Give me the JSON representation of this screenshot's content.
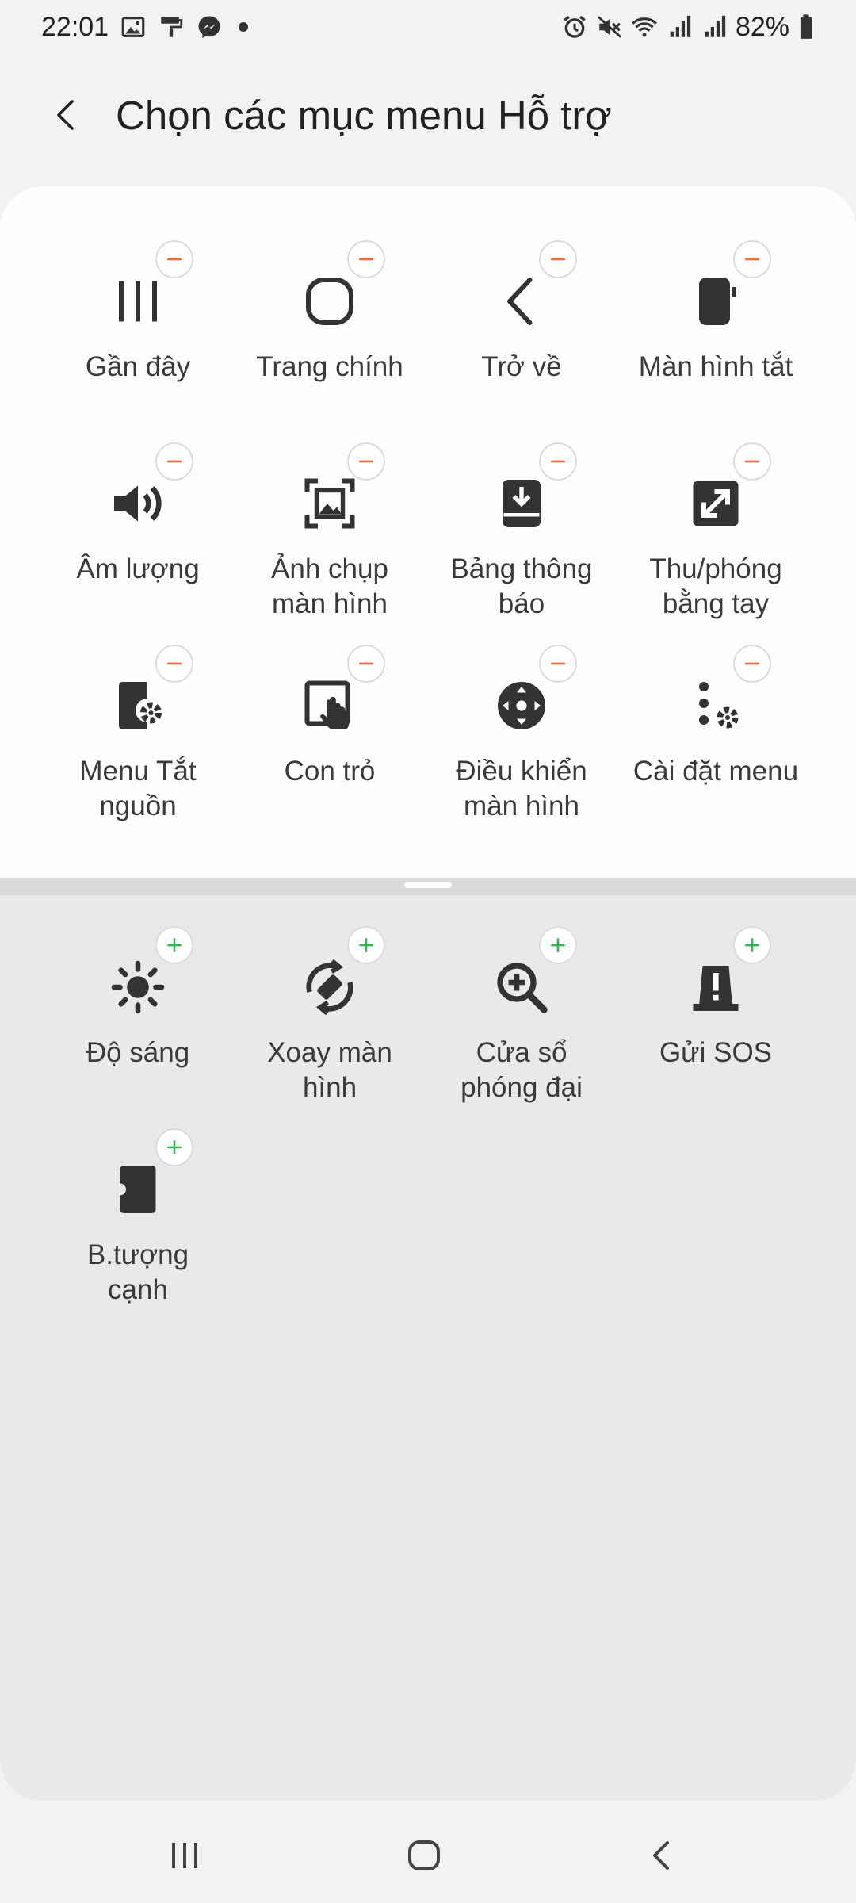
{
  "status_bar": {
    "time": "22:01",
    "battery": "82%",
    "left_icons": [
      "gallery-icon",
      "paint-roller-icon",
      "messenger-icon"
    ],
    "right_icons": [
      "alarm-icon",
      "mute-icon",
      "wifi-icon",
      "signal-icon",
      "signal-icon",
      "battery-icon"
    ]
  },
  "header": {
    "title": "Chọn các mục menu Hỗ trợ"
  },
  "colors": {
    "remove_badge": "#f06a3a",
    "add_badge": "#2fb34d",
    "icon": "#333333",
    "active_bg": "#fdfdfd",
    "available_bg": "#e9e9e9"
  },
  "active_items": [
    {
      "label": "Gần đây",
      "icon": "recents-icon"
    },
    {
      "label": "Trang chính",
      "icon": "home-icon"
    },
    {
      "label": "Trở về",
      "icon": "back-icon"
    },
    {
      "label": "Màn hình tắt",
      "icon": "screen-off-icon"
    },
    {
      "label": "Âm lượng",
      "icon": "volume-icon"
    },
    {
      "label": "Ảnh chụp\nmàn hình",
      "icon": "screenshot-icon"
    },
    {
      "label": "Bảng thông\nbáo",
      "icon": "notification-panel-icon"
    },
    {
      "label": "Thu/phóng\nbằng tay",
      "icon": "pinch-zoom-icon"
    },
    {
      "label": "Menu Tắt\nnguồn",
      "icon": "power-menu-icon"
    },
    {
      "label": "Con trỏ",
      "icon": "cursor-icon"
    },
    {
      "label": "Điều khiển\nmàn hình",
      "icon": "screen-control-icon"
    },
    {
      "label": "Cài đặt menu",
      "icon": "menu-settings-icon"
    }
  ],
  "available_items": [
    {
      "label": "Độ sáng",
      "icon": "brightness-icon"
    },
    {
      "label": "Xoay màn\nhình",
      "icon": "rotate-screen-icon"
    },
    {
      "label": "Cửa sổ\nphóng đại",
      "icon": "magnifier-icon"
    },
    {
      "label": "Gửi SOS",
      "icon": "sos-icon"
    },
    {
      "label": "B.tượng\ncạnh",
      "icon": "edge-panel-icon"
    }
  ],
  "nav_bar": {
    "buttons": [
      "recents-nav-icon",
      "home-nav-icon",
      "back-nav-icon"
    ]
  }
}
